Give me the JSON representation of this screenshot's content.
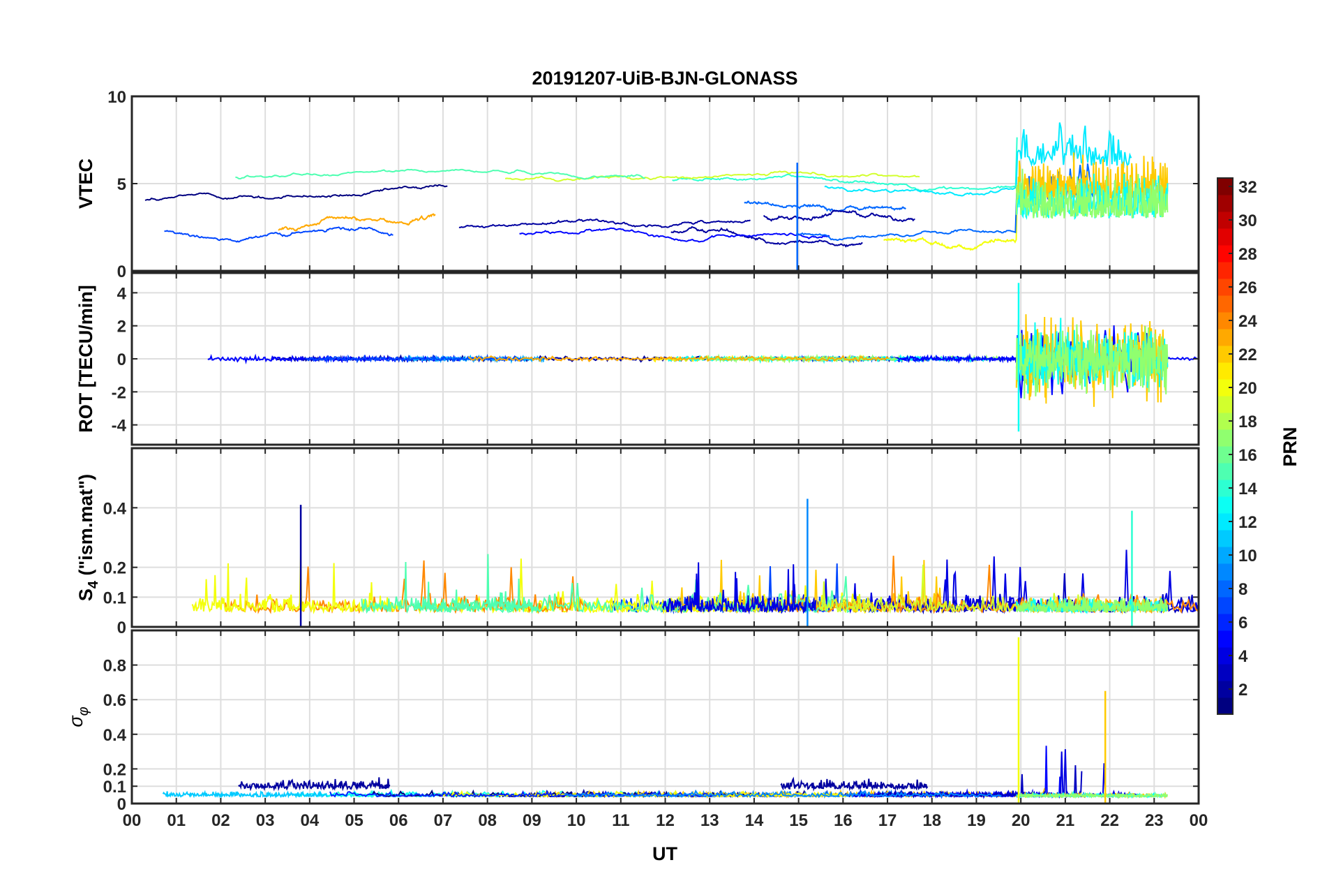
{
  "chart_data": {
    "type": "line",
    "title": "20191207-UiB-BJN-GLONASS",
    "xlabel": "UT",
    "x_ticks": [
      "00",
      "01",
      "02",
      "03",
      "04",
      "05",
      "06",
      "07",
      "08",
      "09",
      "10",
      "11",
      "12",
      "13",
      "14",
      "15",
      "16",
      "17",
      "18",
      "19",
      "20",
      "21",
      "22",
      "23",
      "00"
    ],
    "xlim": [
      0,
      24
    ],
    "grid": true,
    "colorbar": {
      "label": "PRN",
      "range": [
        1,
        32
      ],
      "ticks": [
        "2",
        "4",
        "6",
        "8",
        "10",
        "12",
        "14",
        "16",
        "18",
        "20",
        "22",
        "24",
        "26",
        "28",
        "30",
        "32"
      ],
      "colormap": "jet"
    },
    "panels": [
      {
        "ylabel": "VTEC",
        "ylim": [
          0,
          10
        ],
        "yticks": [
          "0",
          "5",
          "10"
        ],
        "description_values": {
          "quiet_level_0_to_19UT": [
            1.5,
            5.5
          ],
          "disturbed_20_to_23UT_max": 8.5,
          "spike_near_15UT": 6.2
        }
      },
      {
        "ylabel": "ROT [TECU/min]",
        "ylim": [
          -5.2,
          5.2
        ],
        "yticks": [
          "-4",
          "-2",
          "0",
          "2",
          "4"
        ],
        "description_values": {
          "quiet_amplitude": 0.4,
          "disturbed_20_to_23UT_amplitude": 4.5,
          "min_spike_near_20UT": -4.4,
          "max_spike_near_20UT": 4.6
        }
      },
      {
        "ylabel": "S4 (\"ism.mat\")",
        "ylabel_main": "S",
        "ylabel_sub": "4",
        "ylabel_rest": " (\"ism.mat\")",
        "ylim": [
          0,
          0.6
        ],
        "yticks": [
          "0",
          "0.1",
          "0.2",
          "0.4"
        ],
        "description_values": {
          "baseline": 0.05,
          "peak_near_3_8UT": 0.41,
          "peak_near_15_2UT": 0.43,
          "peak_near_22_5UT": 0.39
        }
      },
      {
        "ylabel": "σφ",
        "ylabel_main": "σ",
        "ylabel_sub": "φ",
        "ylim": [
          0,
          1
        ],
        "yticks": [
          "0",
          "0.1",
          "0.2",
          "0.4",
          "0.6",
          "0.8"
        ],
        "description_values": {
          "baseline": 0.04,
          "prn_band_3_to_6UT": 0.12,
          "prn_band_15_to_18UT": 0.12,
          "peak_near_20UT": 0.96,
          "peak_near_22UT": 0.65
        }
      }
    ]
  }
}
